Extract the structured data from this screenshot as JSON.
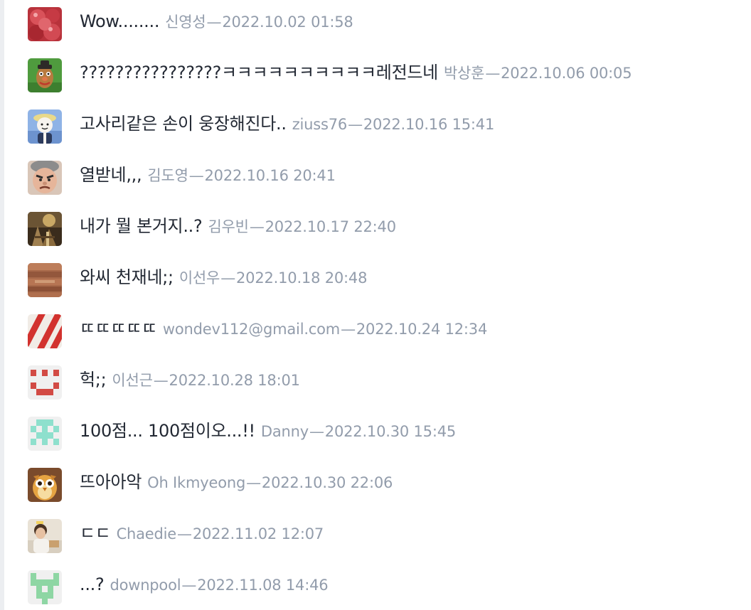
{
  "comments": [
    {
      "message": "Wow........",
      "author": "신영성",
      "date": "2022.10.02 01:58",
      "avatar": "red-fruit-avatar"
    },
    {
      "message": "????????????????ㅋㅋㅋㅋㅋㅋㅋㅋㅋㅋ레전드네",
      "author": "박상훈",
      "date": "2022.10.06 00:05",
      "avatar": "potato-character-avatar"
    },
    {
      "message": "고사리같은 손이 웅장해진다..",
      "author": "ziuss76",
      "date": "2022.10.16 15:41",
      "avatar": "cartoon-character-avatar"
    },
    {
      "message": "열받네,,,",
      "author": "김도영",
      "date": "2022.10.16 20:41",
      "avatar": "angry-face-avatar"
    },
    {
      "message": "내가 뭘 본거지..?",
      "author": "김우빈",
      "date": "2022.10.17 22:40",
      "avatar": "painting-avatar"
    },
    {
      "message": "와씨 천재네;;",
      "author": "이선우",
      "date": "2022.10.18 20:48",
      "avatar": "wood-texture-avatar"
    },
    {
      "message": "ㄸㄸㄸㄸㄸ",
      "author": "wondev112@gmail.com",
      "date": "2022.10.24 12:34",
      "avatar": "striped-avatar"
    },
    {
      "message": "헉;;",
      "author": "이선근",
      "date": "2022.10.28 18:01",
      "avatar": "red-identicon-avatar"
    },
    {
      "message": "100점... 100점이오...!!",
      "author": "Danny",
      "date": "2022.10.30 15:45",
      "avatar": "teal-identicon-avatar"
    },
    {
      "message": "뜨아아악",
      "author": "Oh Ikmyeong",
      "date": "2022.10.30 22:06",
      "avatar": "owl-avatar"
    },
    {
      "message": "ㄷㄷ",
      "author": "Chaedie",
      "date": "2022.11.02 12:07",
      "avatar": "person-photo-avatar"
    },
    {
      "message": "...?",
      "author": "downpool",
      "date": "2022.11.08 14:46",
      "avatar": "green-identicon-avatar"
    }
  ],
  "separator": "—",
  "colors": {
    "message_text": "#222833",
    "meta_text": "#929cab",
    "left_rule": "#eceef1"
  }
}
